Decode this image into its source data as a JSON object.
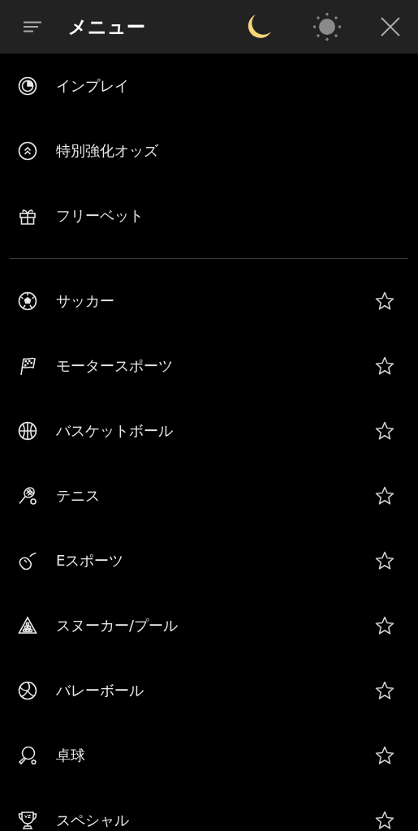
{
  "header": {
    "title": "メニュー",
    "theme_modes": [
      {
        "kind": "moon",
        "selected": true
      },
      {
        "kind": "sun",
        "selected": false
      }
    ]
  },
  "top_items": [
    {
      "kind": "inplay",
      "label": "インプレイ"
    },
    {
      "kind": "boost",
      "label": "特別強化オッズ"
    },
    {
      "kind": "gift",
      "label": "フリーベット"
    }
  ],
  "sports": [
    {
      "kind": "soccer",
      "label": "サッカー",
      "favorite": false
    },
    {
      "kind": "flag",
      "label": "モータースポーツ",
      "favorite": false
    },
    {
      "kind": "basketball",
      "label": "バスケットボール",
      "favorite": false
    },
    {
      "kind": "tennis",
      "label": "テニス",
      "favorite": false
    },
    {
      "kind": "mouse",
      "label": "Eスポーツ",
      "favorite": false
    },
    {
      "kind": "billiards",
      "label": "スヌーカー/プール",
      "favorite": false
    },
    {
      "kind": "volleyball",
      "label": "バレーボール",
      "favorite": false
    },
    {
      "kind": "pingpong",
      "label": "卓球",
      "favorite": false
    },
    {
      "kind": "trophy",
      "label": "スペシャル",
      "favorite": false
    }
  ]
}
